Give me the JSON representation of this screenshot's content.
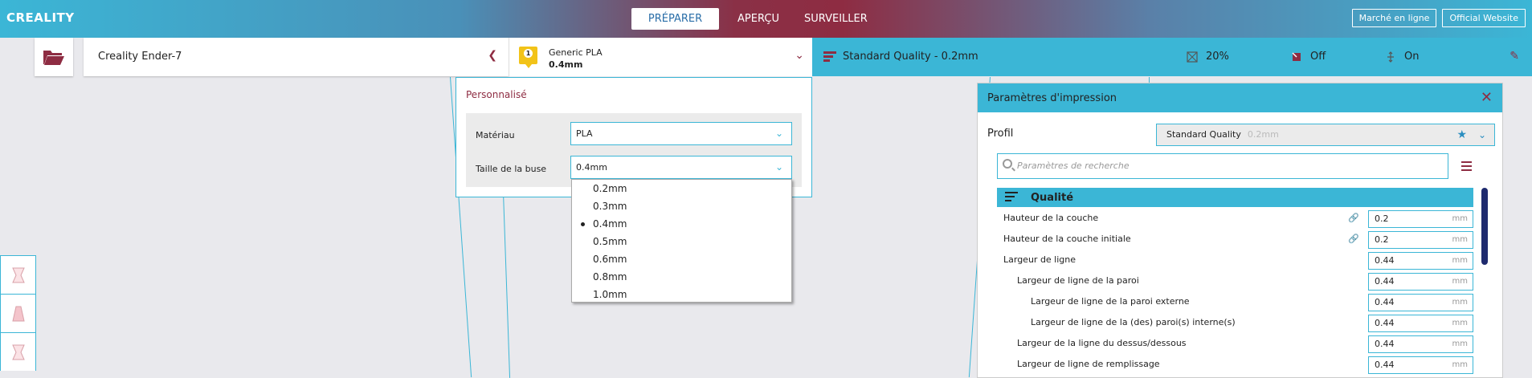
{
  "header": {
    "logo": "CREALITY",
    "tabs": [
      "PRÉPARER",
      "APERÇU",
      "SURVEILLER"
    ],
    "buttons": [
      "Marché en ligne",
      "Official Website"
    ]
  },
  "toolbar": {
    "printer": "Creality Ender-7",
    "material_name": "Generic PLA",
    "material_size": "0.4mm",
    "material_badge": "1",
    "quality": "Standard Quality - 0.2mm",
    "infill": "20%",
    "support": "Off",
    "adhesion": "On"
  },
  "material_popup": {
    "title": "Personnalisé",
    "material_label": "Matériau",
    "material_value": "PLA",
    "nozzle_label": "Taille de la buse",
    "nozzle_value": "0.4mm",
    "nozzle_options": [
      "0.2mm",
      "0.3mm",
      "0.4mm",
      "0.5mm",
      "0.6mm",
      "0.8mm",
      "1.0mm"
    ],
    "selected_option": "0.4mm"
  },
  "settings": {
    "title": "Paramètres d'impression",
    "profile_label": "Profil",
    "profile_value": "Standard Quality",
    "profile_sub": "0.2mm",
    "search_placeholder": "Paramètres de recherche",
    "category": "Qualité",
    "rows": [
      {
        "label": "Hauteur de la couche",
        "value": "0.2",
        "unit": "mm",
        "indent": 0,
        "linked": true
      },
      {
        "label": "Hauteur de la couche initiale",
        "value": "0.2",
        "unit": "mm",
        "indent": 0,
        "linked": true
      },
      {
        "label": "Largeur de ligne",
        "value": "0.44",
        "unit": "mm",
        "indent": 0,
        "linked": false
      },
      {
        "label": "Largeur de ligne de la paroi",
        "value": "0.44",
        "unit": "mm",
        "indent": 1,
        "linked": false
      },
      {
        "label": "Largeur de ligne de la paroi externe",
        "value": "0.44",
        "unit": "mm",
        "indent": 2,
        "linked": false
      },
      {
        "label": "Largeur de ligne de la (des) paroi(s) interne(s)",
        "value": "0.44",
        "unit": "mm",
        "indent": 2,
        "linked": false
      },
      {
        "label": "Largeur de la ligne du dessus/dessous",
        "value": "0.44",
        "unit": "mm",
        "indent": 1,
        "linked": false
      },
      {
        "label": "Largeur de ligne de remplissage",
        "value": "0.44",
        "unit": "mm",
        "indent": 1,
        "linked": false
      }
    ]
  },
  "colors": {
    "accent": "#3bb6d6",
    "brand": "#8e2c42"
  }
}
